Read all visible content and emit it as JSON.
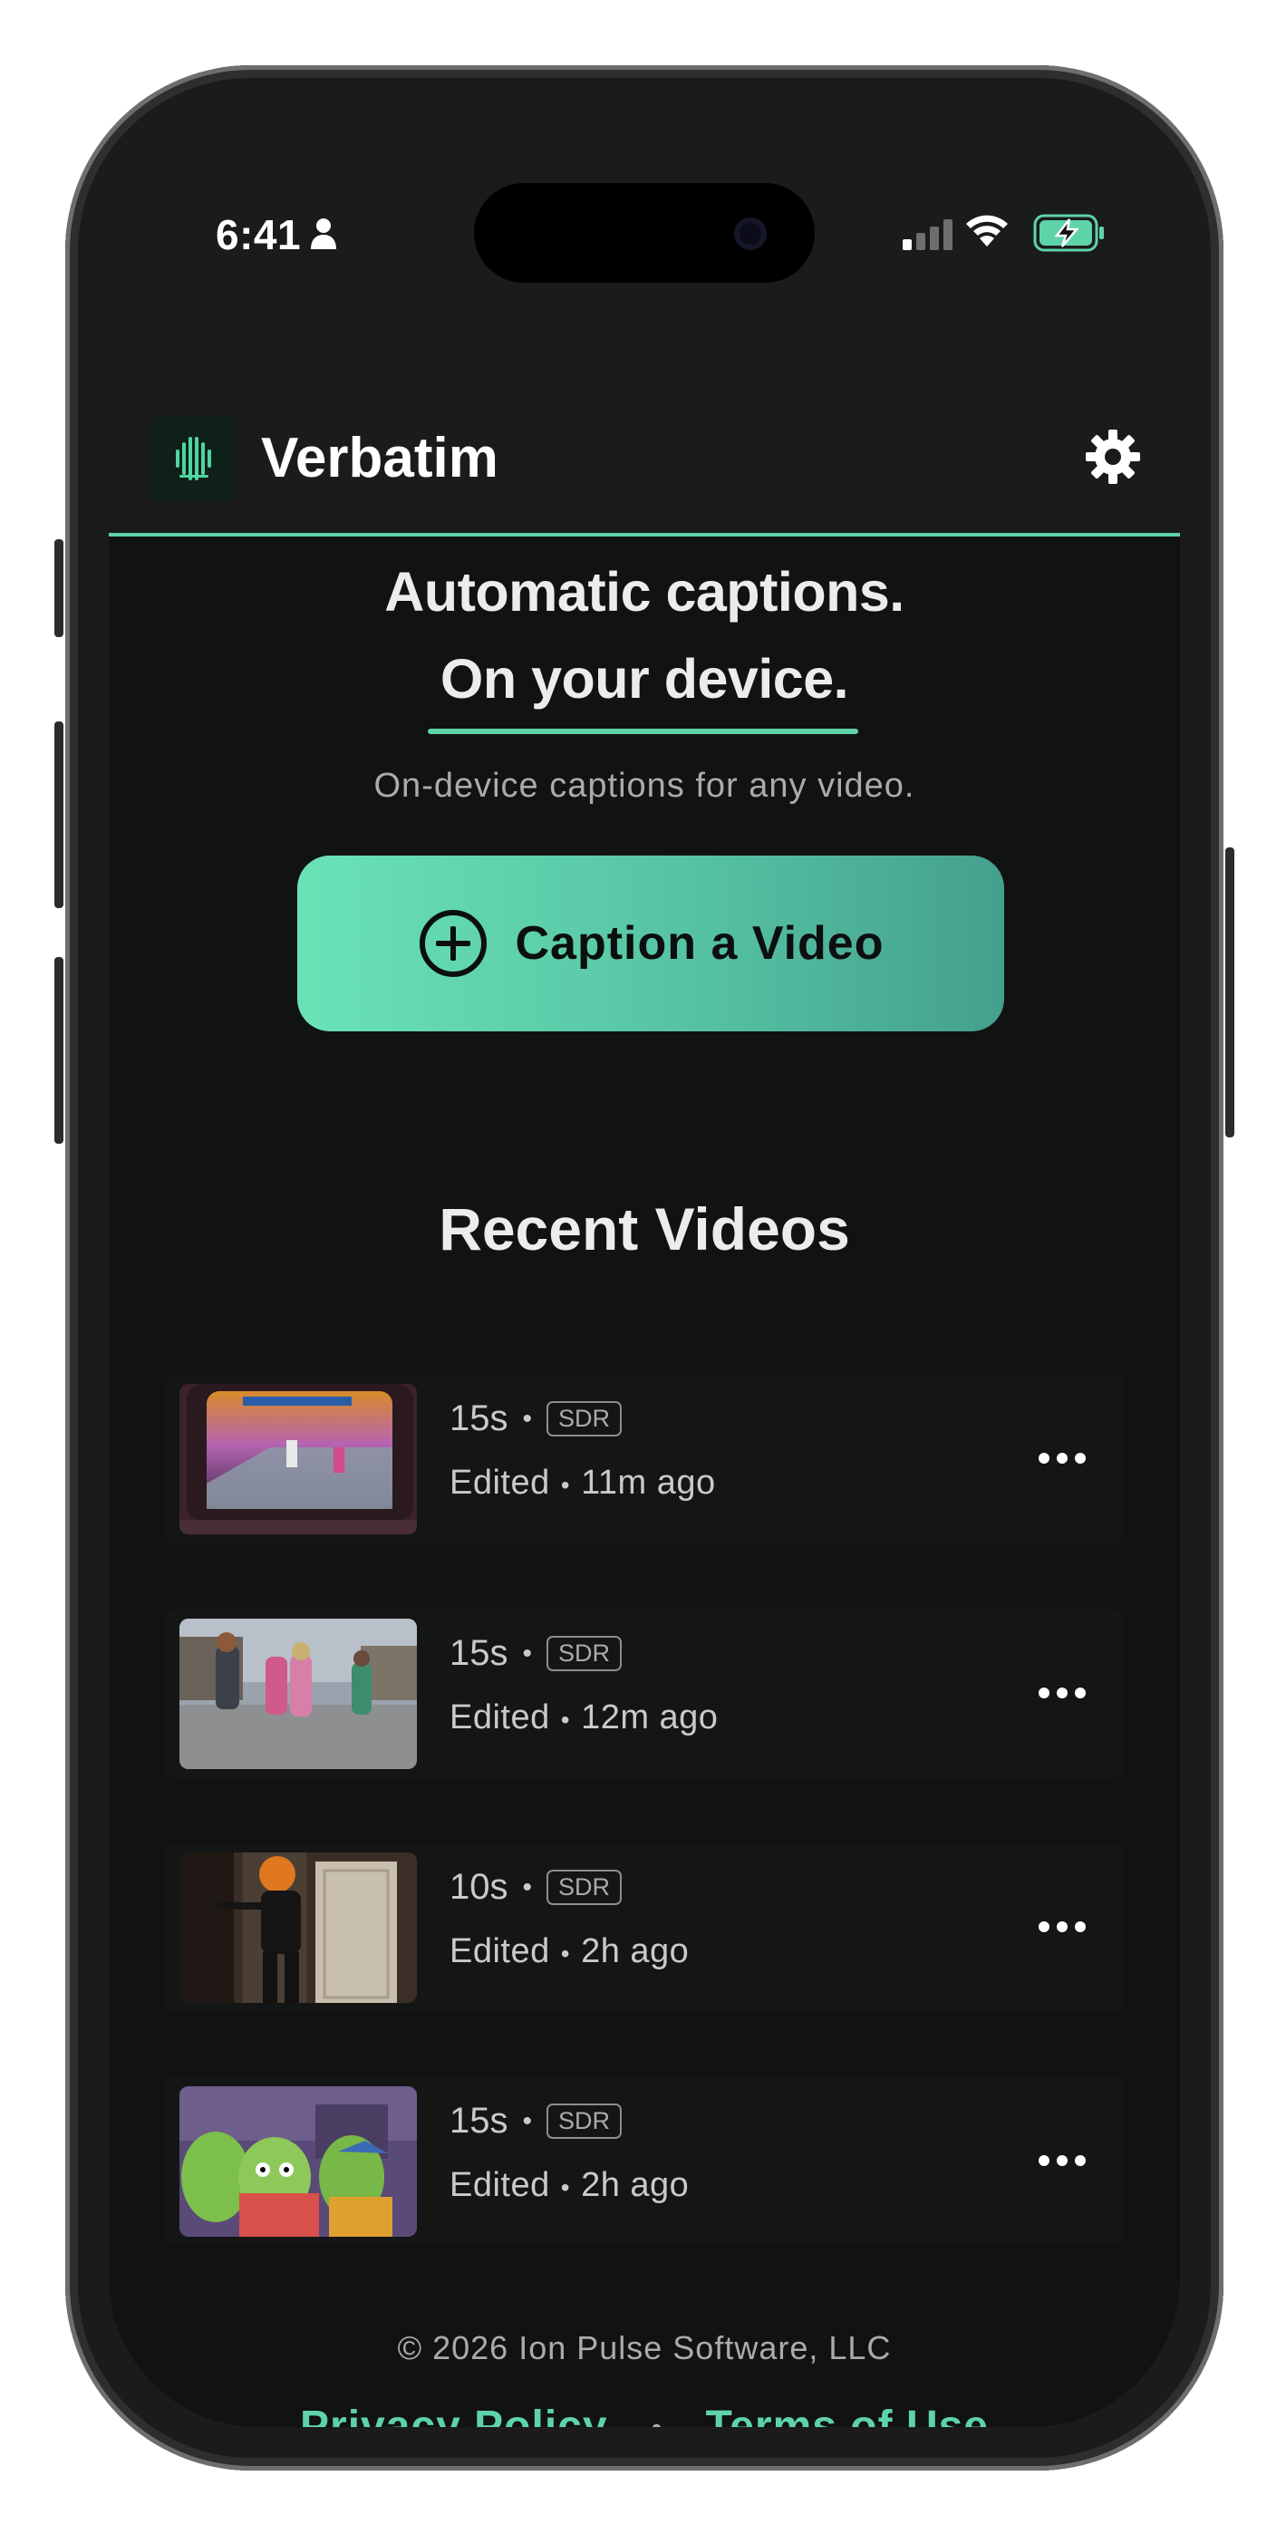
{
  "status_bar": {
    "time": "6:41",
    "colors": {
      "battery": "#5fd3a8"
    }
  },
  "app": {
    "title": "Verbatim",
    "accent_color": "#5fd3a8"
  },
  "hero": {
    "line1": "Automatic captions.",
    "line2": "On your device.",
    "subtitle": "On-device captions for any video."
  },
  "primary_action": {
    "label": "Caption a Video",
    "icon": "plus-circle-icon"
  },
  "recent": {
    "title": "Recent Videos",
    "items": [
      {
        "duration": "15s",
        "badge": "SDR",
        "status": "Edited",
        "age": "11m ago"
      },
      {
        "duration": "15s",
        "badge": "SDR",
        "status": "Edited",
        "age": "12m ago"
      },
      {
        "duration": "10s",
        "badge": "SDR",
        "status": "Edited",
        "age": "2h ago"
      },
      {
        "duration": "15s",
        "badge": "SDR",
        "status": "Edited",
        "age": "2h ago"
      }
    ]
  },
  "footer": {
    "copyright": "© 2026 Ion Pulse Software, LLC",
    "privacy": "Privacy Policy",
    "separator": "•",
    "terms": "Terms of Use"
  }
}
